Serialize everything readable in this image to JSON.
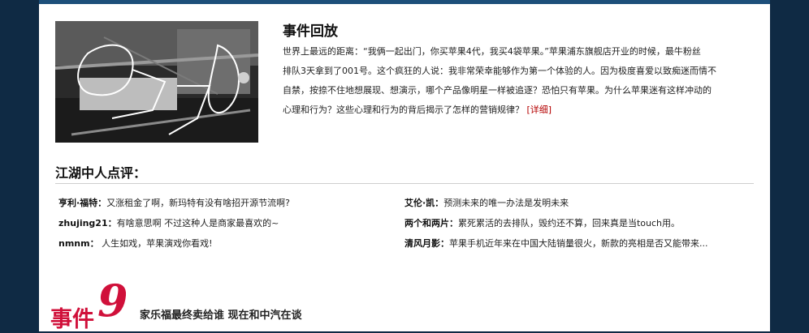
{
  "event_recap": {
    "title": "事件回放",
    "text": "世界上最远的距离：“我俩一起出门，你买苹果4代，我买4袋苹果。”苹果浦东旗舰店开业的时候，最牛粉丝\n排队3天拿到了001号。这个疯狂的人说：我非常荣幸能够作为第一个体验的人。因为极度喜爱以致痴迷而情不\n自禁，按捺不住地想展现、想演示，哪个产品像明星一样被追逐？恐怕只有苹果。为什么苹果迷有这样冲动的\n心理和行为？这些心理和行为的背后揭示了怎样的营销规律？",
    "more_link": "[详细]"
  },
  "comments": {
    "title": "江湖中人点评：",
    "left": [
      {
        "name": "亨利·福特：",
        "text": "又涨租金了啊，新玛特有没有啥招开源节流啊?"
      },
      {
        "name": "zhujing21：",
        "text": "有啥意思啊 不过这种人是商家最喜欢的~"
      },
      {
        "name": "nmnm：",
        "text": " 人生如戏，苹果演戏你看戏!"
      }
    ],
    "right": [
      {
        "name": "艾伦·凯：",
        "text": "预测未来的唯一办法是发明未来"
      },
      {
        "name": "两个和两片：",
        "text": "累死累活的去排队，毁约还不算，回来真是当touch用。"
      },
      {
        "name": "清风月影：",
        "text": "苹果手机近年来在中国大陆销量很火，新款的亮相是否又能带来..."
      }
    ]
  },
  "next_event": {
    "label": "事件",
    "number": "9",
    "subtitle": "家乐福最终卖给谁  现在和中汽在谈"
  },
  "colors": {
    "background": "#0f2a44",
    "accent_bar": "#1d4f7a",
    "event_red": "#d0103a",
    "link_red": "#b40000"
  }
}
